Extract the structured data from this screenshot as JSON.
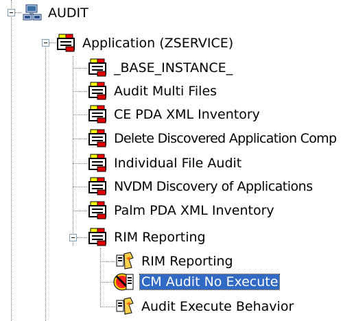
{
  "tree": {
    "root": {
      "label": "AUDIT",
      "icon": "computer-network-icon"
    },
    "application": {
      "label": "Application (ZSERVICE)",
      "icon": "service-package-icon"
    },
    "instances": [
      {
        "label": "_BASE_INSTANCE_",
        "icon": "service-package-icon"
      },
      {
        "label": "Audit Multi Files",
        "icon": "service-package-icon"
      },
      {
        "label": "CE PDA XML Inventory",
        "icon": "service-package-icon"
      },
      {
        "label": "Delete Discovered Application Comp",
        "icon": "service-package-icon"
      },
      {
        "label": "Individual File Audit",
        "icon": "service-package-icon"
      },
      {
        "label": "NVDM Discovery of Applications",
        "icon": "service-package-icon"
      },
      {
        "label": "Palm PDA XML Inventory",
        "icon": "service-package-icon"
      },
      {
        "label": "RIM Reporting",
        "icon": "service-package-icon"
      }
    ],
    "rim_children": [
      {
        "label": "RIM Reporting",
        "icon": "behavior-icon",
        "selected": false
      },
      {
        "label": "CM Audit No Execute",
        "icon": "no-execute-behavior-icon",
        "selected": true
      },
      {
        "label": "Audit Execute Behavior",
        "icon": "behavior-icon",
        "selected": false
      }
    ]
  },
  "colors": {
    "selection_bg": "#316ac5",
    "selection_text": "#ffffff",
    "tree_lines": "#808080"
  }
}
